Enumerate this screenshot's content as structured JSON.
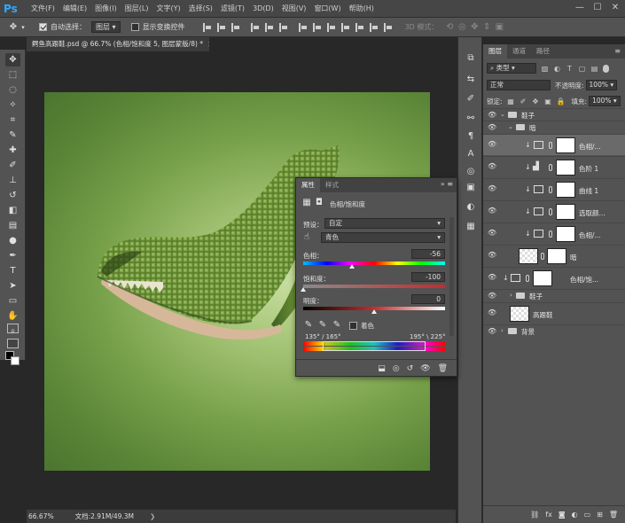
{
  "app": {
    "logo": "Ps"
  },
  "menu": [
    "文件(F)",
    "编辑(E)",
    "图像(I)",
    "图层(L)",
    "文字(Y)",
    "选择(S)",
    "滤镜(T)",
    "3D(D)",
    "视图(V)",
    "窗口(W)",
    "帮助(H)"
  ],
  "window_controls": {
    "minimize": "—",
    "maximize": "☐",
    "close": "✕"
  },
  "options": {
    "auto_select_label": "自动选择：",
    "auto_select_value": "图层",
    "show_transform_label": "显示变换控件",
    "mode_3d": "3D 模式："
  },
  "document": {
    "tab_title": "鳄鱼高跟鞋.psd @ 66.7% (色相/饱和度 5, 图层蒙版/8) *",
    "close": "×",
    "zoom": "66.67%",
    "doc_info": "文档:2.91M/49.3M"
  },
  "layers_panel": {
    "tabs": [
      "图层",
      "通道",
      "路径"
    ],
    "filter_label": "类型",
    "blend_mode": "正常",
    "opacity_label": "不透明度:",
    "opacity_value": "100%",
    "lock_label": "锁定:",
    "fill_label": "填充:",
    "fill_value": "100%",
    "layers": [
      {
        "name": "鞋子",
        "kind": "group"
      },
      {
        "name": "暗",
        "kind": "group"
      },
      {
        "name": "色相/...",
        "kind": "adjustment",
        "selected": true
      },
      {
        "name": "色阶 1",
        "kind": "adjustment"
      },
      {
        "name": "曲线 1",
        "kind": "adjustment"
      },
      {
        "name": "选取颜...",
        "kind": "adjustment"
      },
      {
        "name": "色相/...",
        "kind": "adjustment"
      },
      {
        "name": "暗",
        "kind": "pixel"
      },
      {
        "name": "色相/饱...",
        "kind": "adjustment"
      },
      {
        "name": "鞋子",
        "kind": "group"
      },
      {
        "name": "高跟鞋",
        "kind": "pixel"
      },
      {
        "name": "背景",
        "kind": "group"
      }
    ]
  },
  "properties": {
    "tabs": [
      "属性",
      "样式"
    ],
    "title": "色相/饱和度",
    "preset_label": "预设：",
    "preset_value": "自定",
    "channel_value": "青色",
    "hue_label": "色相：",
    "hue_value": "-56",
    "hue_fraction": 0.344,
    "saturation_label": "饱和度：",
    "saturation_value": "-100",
    "saturation_fraction": 0.0,
    "lightness_label": "明度：",
    "lightness_value": "0",
    "lightness_fraction": 0.5,
    "colorize_label": "着色",
    "range_left": "135° / 165°",
    "range_right": "195° \\ 225°"
  },
  "colors": {
    "accent": "#31a8ff",
    "panel": "#535353",
    "dark": "#282828"
  }
}
